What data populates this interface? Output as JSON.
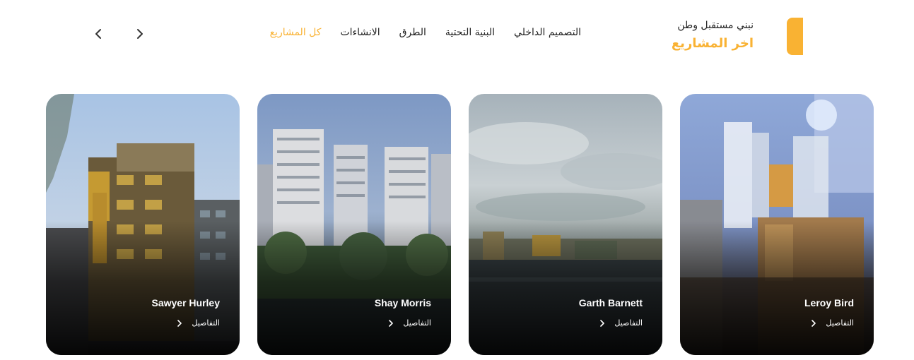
{
  "header": {
    "subtitle": "نبني مستقبل وطن",
    "title": "اخر المشاريع",
    "accent_color": "#f9b233"
  },
  "filters": [
    {
      "label": "كل المشاريع",
      "active": true
    },
    {
      "label": "الانشاءات",
      "active": false
    },
    {
      "label": "الطرق",
      "active": false
    },
    {
      "label": "البنية التحتية",
      "active": false
    },
    {
      "label": "التصميم الداخلي",
      "active": false
    }
  ],
  "carousel": {
    "prev_icon": "chevron-left-icon",
    "next_icon": "chevron-right-icon"
  },
  "projects": [
    {
      "name": "Leroy Bird",
      "details_label": "التفاصيل",
      "image": "interior-room"
    },
    {
      "name": "Garth Barnett",
      "details_label": "التفاصيل",
      "image": "river-cloudy-sky"
    },
    {
      "name": "Shay Morris",
      "details_label": "التفاصيل",
      "image": "highrise-towers"
    },
    {
      "name": "Sawyer Hurley",
      "details_label": "التفاصيل",
      "image": "apartment-building"
    }
  ]
}
